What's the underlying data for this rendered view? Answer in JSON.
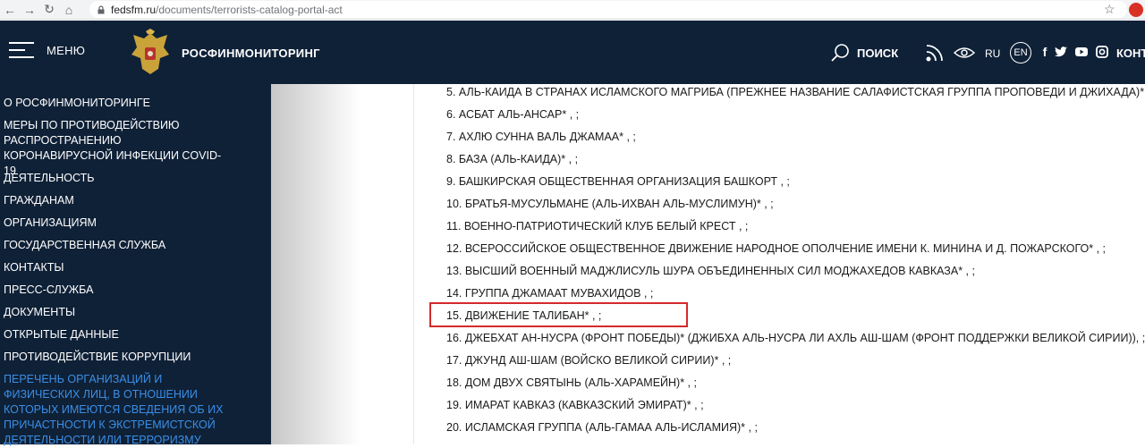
{
  "browser": {
    "back": "←",
    "forward": "→",
    "reload": "↻",
    "home": "⌂",
    "url_host": "fedsfm.ru",
    "url_path": "/documents/terrorists-catalog-portal-act"
  },
  "header": {
    "menu_label": "МЕНЮ",
    "brand": "РОСФИНМОНИТОРИНГ",
    "search_label": "ПОИСК",
    "lang_ru": "RU",
    "lang_en": "EN",
    "contacts_label": "КОНТ",
    "colors": {
      "background": "#0f2137",
      "text": "#ffffff"
    }
  },
  "sidebar": {
    "items": [
      {
        "label": "О РОСФИНМОНИТОРИНГЕ"
      },
      {
        "label": "МЕРЫ ПО ПРОТИВОДЕЙСТВИЮ РАСПРОСТРАНЕНИЮ КОРОНАВИРУСНОЙ ИНФЕКЦИИ COVID-19"
      },
      {
        "label": "ДЕЯТЕЛЬНОСТЬ"
      },
      {
        "label": "ГРАЖДАНАМ"
      },
      {
        "label": "ОРГАНИЗАЦИЯМ"
      },
      {
        "label": "ГОСУДАРСТВЕННАЯ СЛУЖБА"
      },
      {
        "label": "КОНТАКТЫ"
      },
      {
        "label": "ПРЕСС-СЛУЖБА"
      },
      {
        "label": "ДОКУМЕНТЫ"
      },
      {
        "label": "ОТКРЫТЫЕ ДАННЫЕ"
      },
      {
        "label": "ПРОТИВОДЕЙСТВИЕ КОРРУПЦИИ"
      },
      {
        "label": "ПЕРЕЧЕНЬ ОРГАНИЗАЦИЙ И ФИЗИЧЕСКИХ ЛИЦ, В ОТНОШЕНИИ КОТОРЫХ ИМЕЮТСЯ СВЕДЕНИЯ ОБ ИХ ПРИЧАСТНОСТИ К ЭКСТРЕМИСТСКОЙ ДЕЯТЕЛЬНОСТИ ИЛИ ТЕРРОРИЗМУ"
      }
    ],
    "active_color": "#3a8ee6"
  },
  "list": {
    "items": [
      "5. АЛЬ-КАИДА В СТРАНАХ ИСЛАМСКОГО МАГРИБА (ПРЕЖНЕЕ НАЗВАНИЕ САЛАФИСТСКАЯ ГРУППА ПРОПОВЕДИ И ДЖИХАДА)* , ;",
      "6. АСБАТ АЛЬ-АНСАР* , ;",
      "7. АХЛЮ СУННА ВАЛЬ ДЖАМАА* , ;",
      "8. БАЗА (АЛЬ-КАИДА)* , ;",
      "9. БАШКИРСКАЯ ОБЩЕСТВЕННАЯ ОРГАНИЗАЦИЯ БАШКОРТ , ;",
      "10. БРАТЬЯ-МУСУЛЬМАНЕ (АЛЬ-ИХВАН АЛЬ-МУСЛИМУН)* , ;",
      "11. ВОЕННО-ПАТРИОТИЧЕСКИЙ КЛУБ БЕЛЫЙ КРЕСТ , ;",
      "12. ВСЕРОССИЙСКОЕ ОБЩЕСТВЕННОЕ ДВИЖЕНИЕ НАРОДНОЕ ОПОЛЧЕНИЕ ИМЕНИ К. МИНИНА И Д. ПОЖАРСКОГО* , ;",
      "13. ВЫСШИЙ ВОЕННЫЙ МАДЖЛИСУЛЬ ШУРА ОБЪЕДИНЕННЫХ СИЛ МОДЖАХЕДОВ КАВКАЗА* , ;",
      "14. ГРУППА ДЖАМААТ МУВАХИДОВ , ;",
      "15. ДВИЖЕНИЕ ТАЛИБАН* , ;",
      "16. ДЖЕБХАТ АН-НУСРА (ФРОНТ ПОБЕДЫ)* (ДЖИБХА АЛЬ-НУСРА ЛИ АХЛЬ АШ-ШАМ (ФРОНТ ПОДДЕРЖКИ ВЕЛИКОЙ СИРИИ)), ;",
      "17. ДЖУНД АШ-ШАМ (ВОЙСКО ВЕЛИКОЙ СИРИИ)* , ;",
      "18. ДОМ ДВУХ СВЯТЫНЬ (АЛЬ-ХАРАМЕЙН)* , ;",
      "19. ИМАРАТ КАВКАЗ (КАВКАЗСКИЙ ЭМИРАТ)* , ;",
      "20. ИСЛАМСКАЯ ГРУППА (АЛЬ-ГАМАА АЛЬ-ИСЛАМИЯ)* , ;"
    ],
    "highlight_color": "#d42a2a"
  }
}
